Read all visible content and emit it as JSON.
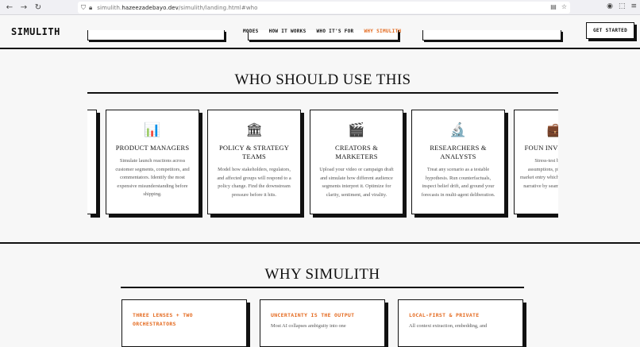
{
  "browser": {
    "url_prefix": "simulith.",
    "url_host": "hazeezadebayo.dev",
    "url_path": "/simulith/landing.html#who",
    "icons": [
      "back-icon",
      "forward-icon",
      "reload-icon",
      "shield-icon",
      "lock-icon",
      "reader-icon",
      "bookmark-star-icon",
      "account-icon",
      "extensions-icon",
      "menu-icon"
    ]
  },
  "header": {
    "logo": "SIMULITH",
    "nav": [
      {
        "label": "MODES",
        "active": false
      },
      {
        "label": "HOW IT WORKS",
        "active": false
      },
      {
        "label": "WHO IT'S FOR",
        "active": false
      },
      {
        "label": "WHY SIMULITH",
        "active": true
      }
    ],
    "cta": "GET STARTED"
  },
  "who": {
    "title": "WHO SHOULD USE THIS",
    "cards": [
      {
        "icon": "📊",
        "icon_name": "bar-chart-icon",
        "title": "PRODUCT MANAGERS",
        "desc": "Simulate launch reactions across customer segments, competitors, and commentators. Identify the most expensive misunderstanding before shipping."
      },
      {
        "icon": "🏛",
        "icon_name": "classical-building-icon",
        "title": "POLICY & STRATEGY TEAMS",
        "desc": "Model how stakeholders, regulators, and affected groups will respond to a policy change. Find the downstream pressure before it hits."
      },
      {
        "icon": "🎬",
        "icon_name": "clapperboard-icon",
        "title": "CREATORS & MARKETERS",
        "desc": "Upload your video or campaign draft and simulate how different audience segments interpret it. Optimize for clarity, sentiment, and virality."
      },
      {
        "icon": "🔬",
        "icon_name": "microscope-icon",
        "title": "RESEARCHERS & ANALYSTS",
        "desc": "Treat any scenario as a testable hypothesis. Run counterfactuals, inspect belief drift, and ground your forecasts in multi-agent deliberation."
      },
      {
        "icon": "💼",
        "icon_name": "briefcase-icon",
        "title": "FOUN INVE",
        "desc": "Stress-test b assumptions, pi market entry which narrative by seam"
      }
    ]
  },
  "why": {
    "title": "WHY SIMULITH",
    "cards": [
      {
        "title": "THREE LENSES + TWO ORCHESTRATORS",
        "desc": ""
      },
      {
        "title": "UNCERTAINTY IS THE OUTPUT",
        "desc": "Most AI collapses ambiguity into one"
      },
      {
        "title": "LOCAL-FIRST & PRIVATE",
        "desc": "All context extraction, embedding, and"
      }
    ]
  },
  "colors": {
    "accent": "#e46a1f",
    "ink": "#111111",
    "bg": "#f7f7f7"
  }
}
